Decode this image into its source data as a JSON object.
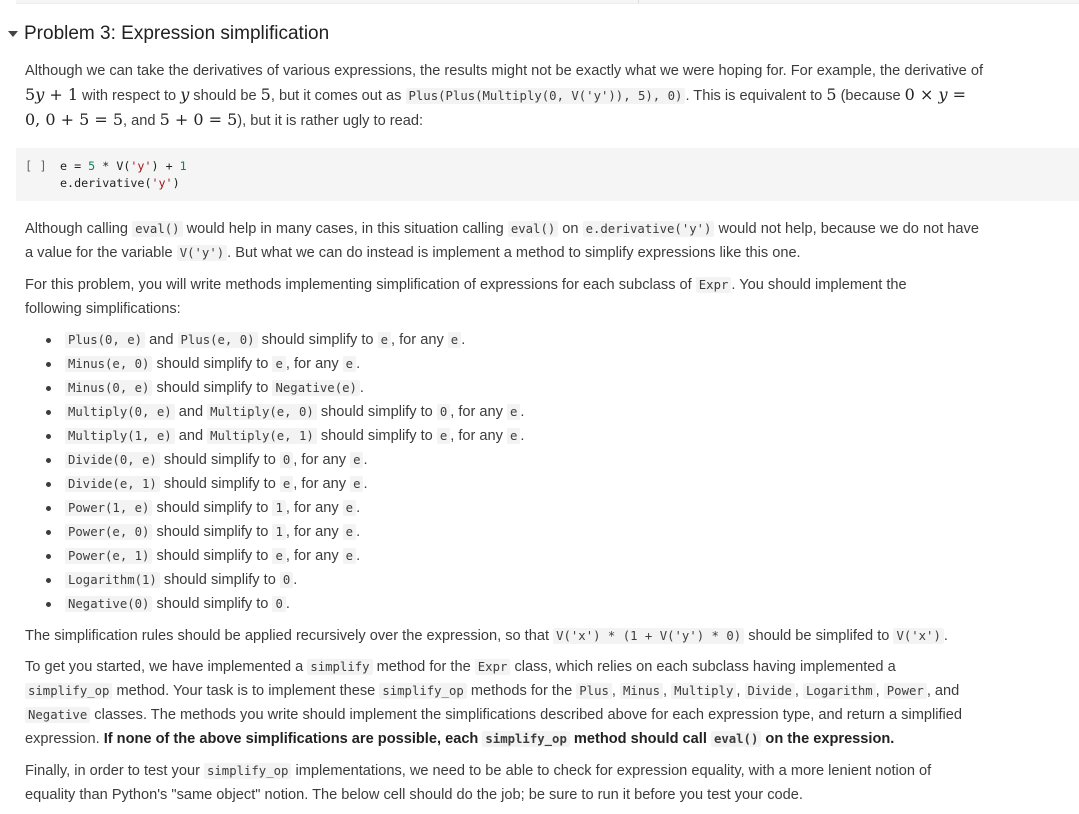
{
  "section": {
    "title": "Problem 3: Expression simplification",
    "caret_icon": "caret-down-icon"
  },
  "intro": {
    "p1_a": "Although we can take the derivatives of various expressions, the results might not be exactly what we were hoping for. For example, the derivative of ",
    "p1_math1": "5y + 1",
    "p1_b": " with respect to ",
    "p1_math2": "y",
    "p1_c": " should be ",
    "p1_math3": "5",
    "p1_d": ", but it comes out as ",
    "p1_code": "Plus(Plus(Multiply(0, V('y')), 5), 0)",
    "p1_e": ". This is equivalent to ",
    "p1_math4": "5",
    "p1_f": " (because ",
    "p1_math5": "0 × y = 0, 0 + 5 = 5",
    "p1_g": ", and ",
    "p1_math6": "5 + 0 = 5",
    "p1_h": "), but it is rather ugly to read:"
  },
  "code_cell": {
    "run_label": "[ ]",
    "line1_a": "e = ",
    "line1_num1": "5",
    "line1_b": " * V(",
    "line1_str": "'y'",
    "line1_c": ") + ",
    "line1_num2": "1",
    "line2_a": "e.derivative(",
    "line2_str": "'y'",
    "line2_b": ")"
  },
  "para2": {
    "a": "Although calling ",
    "code1": "eval()",
    "b": " would help in many cases, in this situation calling ",
    "code2": "eval()",
    "c": " on ",
    "code3": "e.derivative('y')",
    "d": " would not help, because we do not have a value for the variable ",
    "code4": "V('y')",
    "e": ". But what we can do instead is implement a method to simplify expressions like this one."
  },
  "para3": {
    "a": "For this problem, you will write methods implementing simplification of expressions for each subclass of ",
    "code1": "Expr",
    "b": ". You should implement the following simplifications:"
  },
  "rules": [
    {
      "c1": "Plus(0, e)",
      "t1": " and ",
      "c2": "Plus(e, 0)",
      "t2": " should simplify to ",
      "c3": "e",
      "t3": ", for any ",
      "c4": "e",
      "t4": "."
    },
    {
      "c1": "Minus(e, 0)",
      "t1": " should simplify to ",
      "c2": "e",
      "t2": ", for any ",
      "c3": "e",
      "t3": "."
    },
    {
      "c1": "Minus(0, e)",
      "t1": " should simplify to ",
      "c2": "Negative(e)",
      "t2": "."
    },
    {
      "c1": "Multiply(0, e)",
      "t1": " and ",
      "c2": "Multiply(e, 0)",
      "t2": " should simplify to ",
      "c3": "0",
      "t3": ", for any ",
      "c4": "e",
      "t4": "."
    },
    {
      "c1": "Multiply(1, e)",
      "t1": " and ",
      "c2": "Multiply(e, 1)",
      "t2": " should simplify to ",
      "c3": "e",
      "t3": ", for any ",
      "c4": "e",
      "t4": "."
    },
    {
      "c1": "Divide(0, e)",
      "t1": " should simplify to ",
      "c2": "0",
      "t2": ", for any ",
      "c3": "e",
      "t3": "."
    },
    {
      "c1": "Divide(e, 1)",
      "t1": " should simplify to ",
      "c2": "e",
      "t2": ", for any ",
      "c3": "e",
      "t3": "."
    },
    {
      "c1": "Power(1, e)",
      "t1": " should simplify to ",
      "c2": "1",
      "t2": ", for any ",
      "c3": "e",
      "t3": "."
    },
    {
      "c1": "Power(e, 0)",
      "t1": " should simplify to ",
      "c2": "1",
      "t2": ", for any ",
      "c3": "e",
      "t3": "."
    },
    {
      "c1": "Power(e, 1)",
      "t1": " should simplify to ",
      "c2": "e",
      "t2": ", for any ",
      "c3": "e",
      "t3": "."
    },
    {
      "c1": "Logarithm(1)",
      "t1": " should simplify to ",
      "c2": "0",
      "t2": "."
    },
    {
      "c1": "Negative(0)",
      "t1": " should simplify to ",
      "c2": "0",
      "t2": "."
    }
  ],
  "para4": {
    "a": "The simplification rules should be applied recursively over the expression, so that ",
    "code1": "V('x') * (1 + V('y') * 0)",
    "b": " should be simplifed to ",
    "code2": "V('x')",
    "c": "."
  },
  "para5": {
    "a": "To get you started, we have implemented a ",
    "code1": "simplify",
    "b": " method for the ",
    "code2": "Expr",
    "c": " class, which relies on each subclass having implemented a ",
    "code3": "simplify_op",
    "d": " method. Your task is to implement these ",
    "code4": "simplify_op",
    "e": " methods for the ",
    "code5": "Plus",
    "f": ", ",
    "code6": "Minus",
    "g": ", ",
    "code7": "Multiply",
    "h": ", ",
    "code8": "Divide",
    "i": ", ",
    "code9": "Logarithm",
    "j": ", ",
    "code10": "Power",
    "k": ", and ",
    "code11": "Negative",
    "l": " classes. The methods you write should implement the simplifications described above for each expression type, and return a simplified expression. ",
    "bold_a": "If none of the above simplifications are possible, each ",
    "bold_code1": "simplify_op",
    "bold_b": " method should call ",
    "bold_code2": "eval()",
    "bold_c": " on the expression."
  },
  "para6": {
    "a": "Finally, in order to test your ",
    "code1": "simplify_op",
    "b": " implementations, we need to be able to check for expression equality, with a more lenient notion of equality than Python's \"same object\" notion. The below cell should do the job; be sure to run it before you test your code."
  }
}
